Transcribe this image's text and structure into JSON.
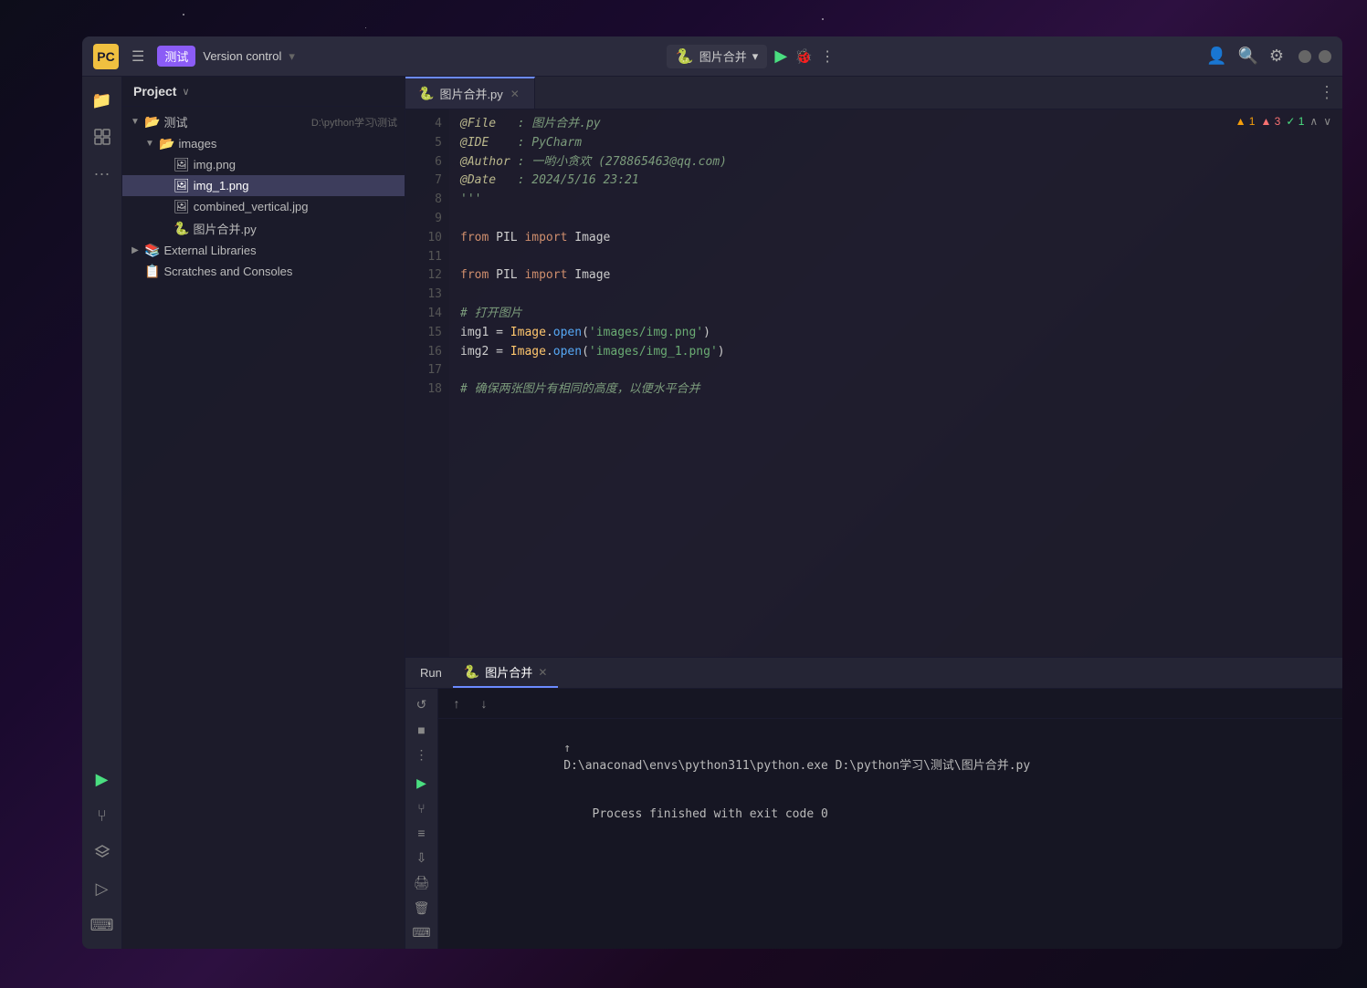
{
  "background": {
    "color": "#0d0d1a"
  },
  "title_bar": {
    "logo": "PC",
    "project_name": "测试",
    "version_control": "Version control",
    "run_config": "图片合并",
    "run_config_arrow": "▾"
  },
  "left_toolbar": {
    "icons": [
      "folder",
      "puzzle",
      "more"
    ]
  },
  "sidebar": {
    "title": "Project",
    "title_arrow": "∨",
    "tree": [
      {
        "label": "测试",
        "path": "D:\\python学习\\测试",
        "type": "folder",
        "indent": 0,
        "expanded": true
      },
      {
        "label": "images",
        "type": "folder",
        "indent": 1,
        "expanded": true
      },
      {
        "label": "img.png",
        "type": "image",
        "indent": 2
      },
      {
        "label": "img_1.png",
        "type": "image",
        "indent": 2,
        "selected": true
      },
      {
        "label": "combined_vertical.jpg",
        "type": "image",
        "indent": 2
      },
      {
        "label": "图片合并.py",
        "type": "python",
        "indent": 2
      },
      {
        "label": "External Libraries",
        "type": "library",
        "indent": 0,
        "expanded": false
      },
      {
        "label": "Scratches and Consoles",
        "type": "scratches",
        "indent": 0
      }
    ]
  },
  "editor": {
    "tab_name": "图片合并.py",
    "warnings": "▲ 1",
    "errors": "▲ 3",
    "ok": "✓ 1",
    "lines": [
      {
        "num": 4,
        "content": "@File   : 图片合并.py",
        "class": "c-comment"
      },
      {
        "num": 5,
        "content": "@IDE    : PyCharm",
        "class": "c-comment"
      },
      {
        "num": 6,
        "content": "@Author : 一哟小贪欢 (278865463@qq.com)",
        "class": "c-comment"
      },
      {
        "num": 7,
        "content": "@Date   : 2024/5/16 23:21",
        "class": "c-comment"
      },
      {
        "num": 8,
        "content": "'''",
        "class": "c-comment"
      },
      {
        "num": 9,
        "content": "",
        "class": ""
      },
      {
        "num": 10,
        "content": "from PIL import Image",
        "class": ""
      },
      {
        "num": 11,
        "content": "",
        "class": ""
      },
      {
        "num": 12,
        "content": "from PIL import Image",
        "class": ""
      },
      {
        "num": 13,
        "content": "",
        "class": ""
      },
      {
        "num": 14,
        "content": "# 打开图片",
        "class": "c-comment"
      },
      {
        "num": 15,
        "content": "img1 = Image.open('images/img.png')",
        "class": "mixed"
      },
      {
        "num": 16,
        "content": "img2 = Image.open('images/img_1.png')",
        "class": "mixed"
      },
      {
        "num": 17,
        "content": "",
        "class": ""
      },
      {
        "num": 18,
        "content": "# 确保两张图片有相同的高度，以便水平合并",
        "class": "c-comment"
      }
    ]
  },
  "run_panel": {
    "tab_name": "图片合并",
    "run_label": "Run",
    "output_lines": [
      "D:\\anaconad\\envs\\python311\\python.exe D:\\python学习\\测试\\图片合并.py",
      "",
      "Process finished with exit code 0"
    ]
  },
  "icons": {
    "play": "▶",
    "debug": "🐞",
    "more_vert": "⋮",
    "user": "👤",
    "search": "🔍",
    "settings": "⚙",
    "minimize": "—",
    "maximize": "□",
    "folder_open": "📁",
    "folder": "📂",
    "python_file": "🐍",
    "image_file": "🖼",
    "library": "📚",
    "scratches": "📋",
    "refresh": "↺",
    "stop": "■",
    "scroll_up": "↑",
    "scroll_down": "↓",
    "wrap": "⇌",
    "scroll_end": "⇩",
    "print": "🖨",
    "trash": "🗑",
    "terminal": "⌨"
  }
}
